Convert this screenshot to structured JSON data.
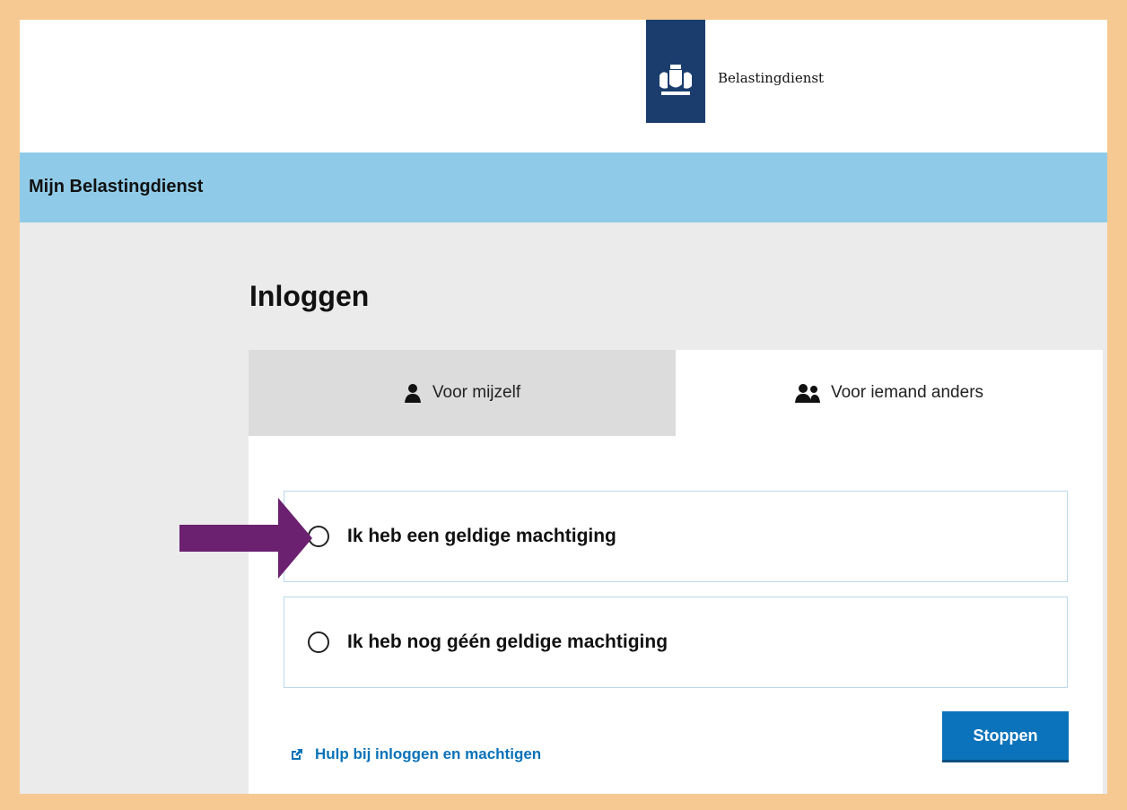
{
  "header": {
    "brand_name": "Belastingdienst",
    "logo_icon": "coat-of-arms-icon",
    "logo_color": "#1a3d6e"
  },
  "nav": {
    "title": "Mijn Belastingdienst",
    "background_color": "#8fcbe8"
  },
  "page": {
    "title": "Inloggen"
  },
  "tabs": [
    {
      "label": "Voor mijzelf",
      "icon": "person-icon",
      "selected": false
    },
    {
      "label": "Voor iemand anders",
      "icon": "people-icon",
      "selected": true
    }
  ],
  "options": [
    {
      "label": "Ik heb een geldige machtiging",
      "checked": false
    },
    {
      "label": "Ik heb nog géén geldige machtiging",
      "checked": false
    }
  ],
  "footer": {
    "help_link": "Hulp bij inloggen en machtigen",
    "help_icon": "external-link-icon",
    "stop_button": "Stoppen"
  },
  "annotation": {
    "arrow_icon": "purple-arrow-icon",
    "arrow_color": "#6b2170"
  },
  "colors": {
    "frame_border": "#f5c991",
    "accent_blue": "#0b73bb"
  }
}
